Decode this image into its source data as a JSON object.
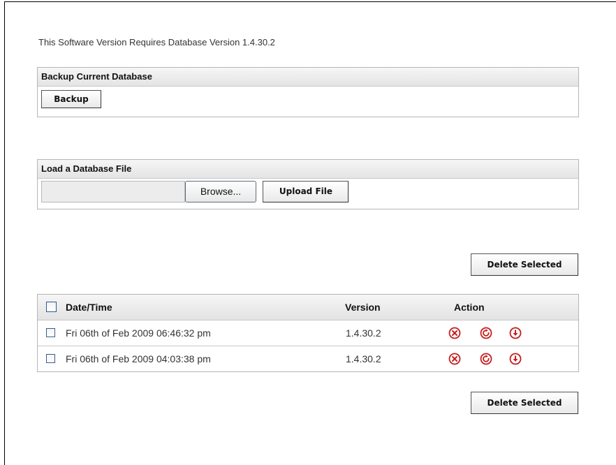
{
  "requirement_text": "This Software Version Requires Database Version 1.4.30.2",
  "backup": {
    "header": "Backup Current Database",
    "button_label": "Backup"
  },
  "load": {
    "header": "Load a Database File",
    "file_value": "",
    "browse_label": "Browse...",
    "upload_label": "Upload File"
  },
  "delete_selected_label": "Delete Selected",
  "table": {
    "columns": [
      "Date/Time",
      "Version",
      "Action"
    ],
    "rows": [
      {
        "datetime": "Fri 06th of Feb 2009 06:46:32 pm",
        "version": "1.4.30.2"
      },
      {
        "datetime": "Fri 06th of Feb 2009 04:03:38 pm",
        "version": "1.4.30.2"
      }
    ],
    "action_icons": [
      "delete-icon",
      "restore-icon",
      "download-icon"
    ]
  },
  "colors": {
    "icon_red": "#c41e1e",
    "header_bg": "#e8e8e8",
    "border": "#b5b5b5",
    "checkbox_border": "#3b5b8c"
  }
}
